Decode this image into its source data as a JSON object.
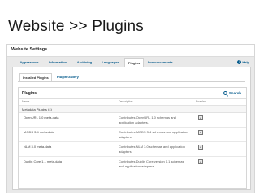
{
  "slide": {
    "title": "Website  >>  Plugins"
  },
  "page": {
    "heading": "Website Settings"
  },
  "tabs": [
    {
      "label": "Appearance"
    },
    {
      "label": "Information"
    },
    {
      "label": "Archiving"
    },
    {
      "label": "Languages"
    },
    {
      "label": "Plugins",
      "active": true
    },
    {
      "label": "Announcements"
    }
  ],
  "help": {
    "label": "Help"
  },
  "subtabs": [
    {
      "label": "Installed Plugins",
      "active": true
    },
    {
      "label": "Plugin Gallery"
    }
  ],
  "grid": {
    "title": "Plugins",
    "search_label": "Search",
    "columns": [
      "Name",
      "Description",
      "Enabled"
    ],
    "category": "Metadata Plugins (4)",
    "rows": [
      {
        "name": "OpenURL 1.0 meta-data",
        "description": "Contributes OpenURL 1.0 schemas and application adapters.",
        "enabled": true
      },
      {
        "name": "MODS 3.4 meta-data",
        "description": "Contributes MODS 3.4 schemas and application adapters.",
        "enabled": true
      },
      {
        "name": "NLM 3.0 meta-data",
        "description": "Contributes NLM 3.0 schemas and application adapters.",
        "enabled": true
      },
      {
        "name": "Dublin Core 1.1 meta-data",
        "description": "Contributes Dublin Core version 1.1 schemas and application adapters.",
        "enabled": true
      }
    ]
  }
}
